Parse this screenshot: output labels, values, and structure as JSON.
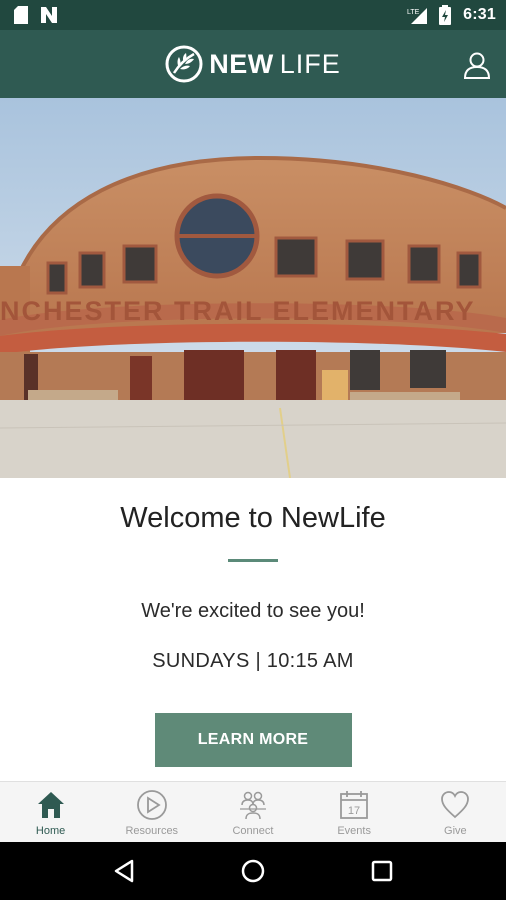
{
  "status_bar": {
    "time": "6:31",
    "network_label": "LTE"
  },
  "app_bar": {
    "logo_new": "NEW",
    "logo_life": "LIFE",
    "logo_icon": "leaf-circle-icon",
    "profile_icon": "user-icon"
  },
  "hero": {
    "image": "school-building-photo",
    "sign_text": "NCHESTER TRAIL ELEMENTARY"
  },
  "main": {
    "title": "Welcome to NewLife",
    "tagline": "We're excited to see you!",
    "service_time": "SUNDAYS | 10:15 AM",
    "button_label": "LEARN MORE"
  },
  "bottom_nav": {
    "items": [
      {
        "label": "Home",
        "icon": "home-icon",
        "active": true
      },
      {
        "label": "Resources",
        "icon": "play-circle-icon",
        "active": false
      },
      {
        "label": "Connect",
        "icon": "group-icon",
        "active": false
      },
      {
        "label": "Events",
        "icon": "calendar-icon",
        "active": false
      },
      {
        "label": "Give",
        "icon": "heart-icon",
        "active": false
      }
    ],
    "calendar_day": "17"
  },
  "colors": {
    "status_bar": "#21483f",
    "app_bar": "#2f5a52",
    "accent": "#5f8a78"
  }
}
